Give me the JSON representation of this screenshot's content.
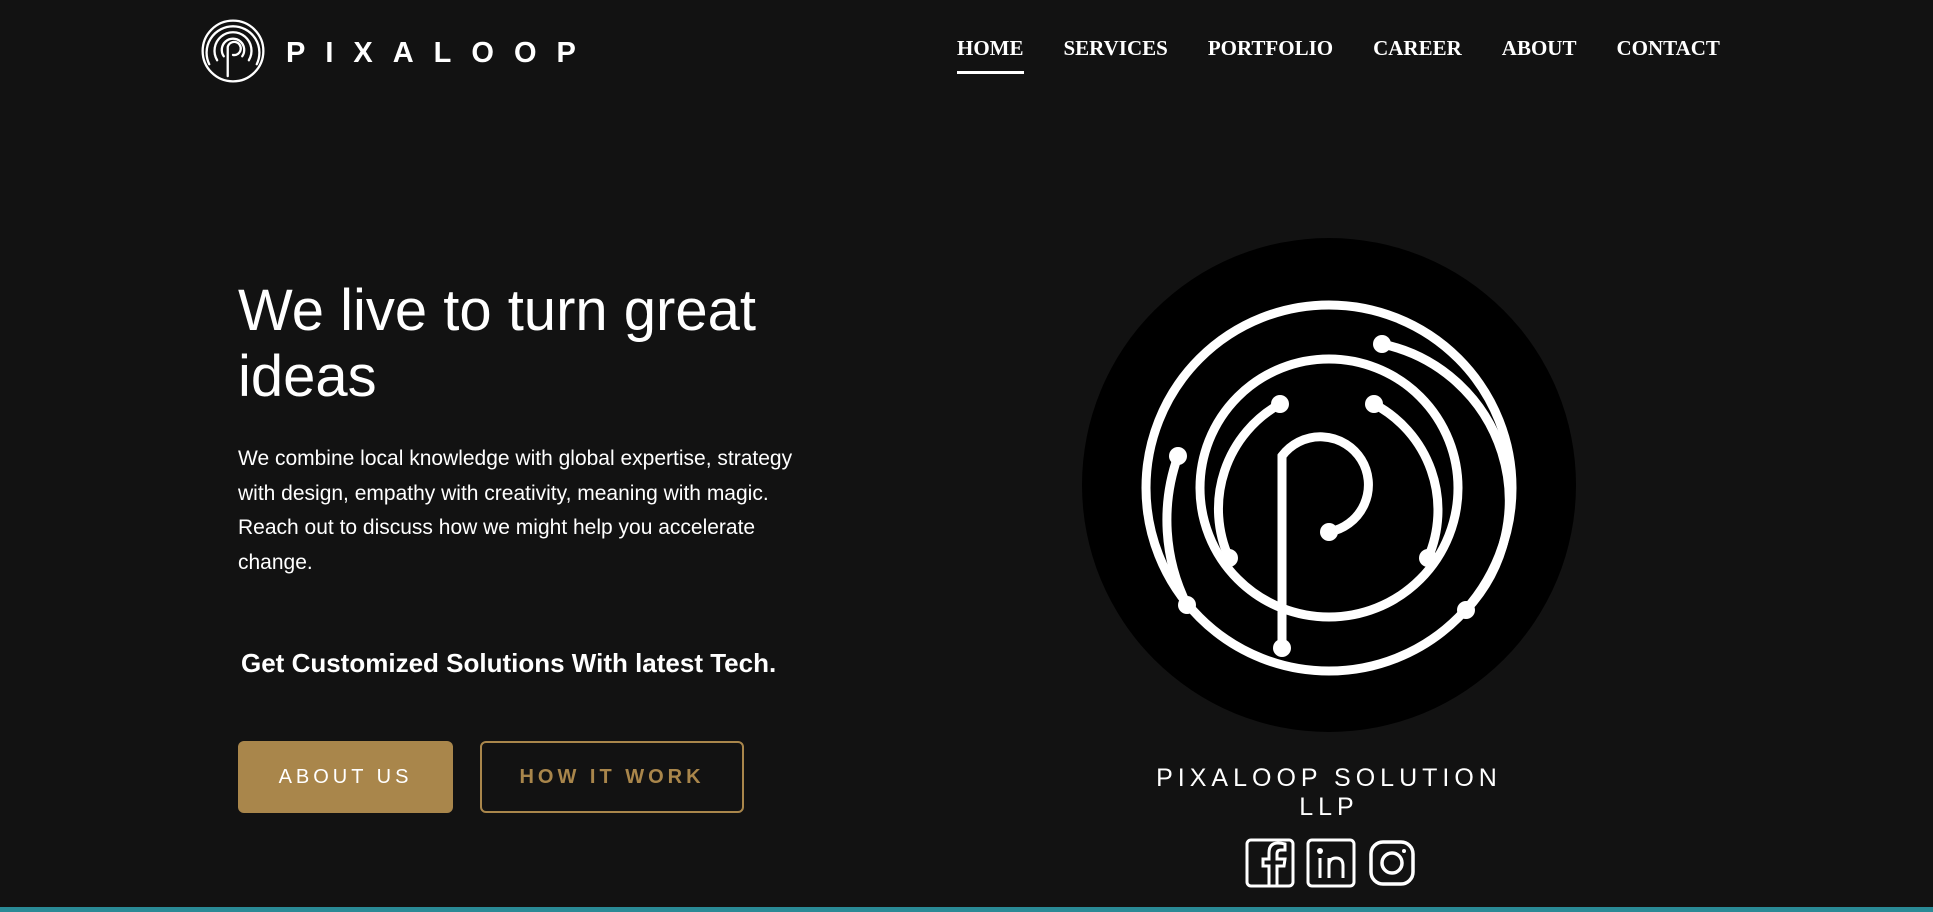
{
  "brand": {
    "name": "PIXALOOP",
    "logo_icon": "pixaloop-logo-icon"
  },
  "nav": {
    "items": [
      {
        "label": "HOME",
        "active": true
      },
      {
        "label": "SERVICES",
        "active": false
      },
      {
        "label": "PORTFOLIO",
        "active": false
      },
      {
        "label": "CAREER",
        "active": false
      },
      {
        "label": "ABOUT",
        "active": false
      },
      {
        "label": "CONTACT",
        "active": false
      }
    ]
  },
  "hero": {
    "title": "We live to turn great ideas",
    "text": "We combine local knowledge with global expertise, strategy with design, empathy with creativity, meaning with magic. Reach out to discuss how we might help you accelerate change.",
    "subtitle": "Get Customized Solutions With latest Tech.",
    "about_button": "ABOUT US",
    "how_button": "HOW IT WORK"
  },
  "emblem": {
    "icon": "pixaloop-emblem-icon",
    "company_name": "PIXALOOP SOLUTION LLP"
  },
  "socials": [
    {
      "icon": "facebook-icon"
    },
    {
      "icon": "linkedin-icon"
    },
    {
      "icon": "instagram-icon"
    }
  ],
  "colors": {
    "background": "#121212",
    "accent": "#a9864b",
    "text": "#ffffff",
    "strip": "#2a8a96"
  }
}
